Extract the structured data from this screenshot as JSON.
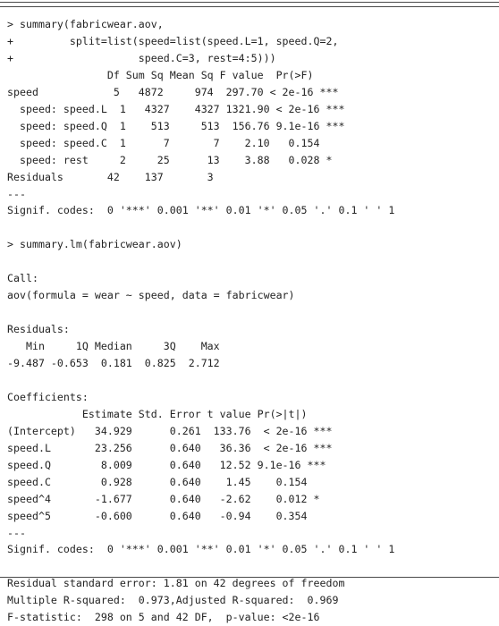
{
  "document": {
    "kind": "r-console-transcript",
    "top_rule_count": 2,
    "bottom_rule_count": 1,
    "text_color": "#232323",
    "background_color": "#ffffff"
  },
  "console": {
    "prompt_symbol": ">",
    "continuation_symbol": "+",
    "blocks": [
      {
        "name": "anova-summary-call",
        "lines": [
          "> summary(fabricwear.aov,",
          "+         split=list(speed=list(speed.L=1, speed.Q=2,",
          "+                    speed.C=3, rest=4:5)))"
        ]
      },
      {
        "name": "anova-table",
        "lines": [
          "                Df Sum Sq Mean Sq F value  Pr(>F)",
          "speed            5   4872     974  297.70 < 2e-16 ***",
          "  speed: speed.L  1   4327    4327 1321.90 < 2e-16 ***",
          "  speed: speed.Q  1    513     513  156.76 9.1e-16 ***",
          "  speed: speed.C  1      7       7    2.10   0.154",
          "  speed: rest     2     25      13    3.88   0.028 *",
          "Residuals       42    137       3",
          "---",
          "Signif. codes:  0 '***' 0.001 '**' 0.01 '*' 0.05 '.' 0.1 ' ' 1"
        ]
      },
      {
        "name": "lm-summary-call",
        "lines": [
          "> summary.lm(fabricwear.aov)"
        ]
      },
      {
        "name": "call-section",
        "lines": [
          "Call:",
          "aov(formula = wear ~ speed, data = fabricwear)"
        ]
      },
      {
        "name": "residuals-section",
        "lines": [
          "Residuals:",
          "   Min     1Q Median     3Q    Max",
          "-9.487 -0.653  0.181  0.825  2.712"
        ]
      },
      {
        "name": "coefficients-section",
        "lines": [
          "Coefficients:",
          "            Estimate Std. Error t value Pr(>|t|)",
          "(Intercept)   34.929      0.261  133.76  < 2e-16 ***",
          "speed.L       23.256      0.640   36.36  < 2e-16 ***",
          "speed.Q        8.009      0.640   12.52 9.1e-16 ***",
          "speed.C        0.928      0.640    1.45    0.154",
          "speed^4       -1.677      0.640   -2.62    0.012 *",
          "speed^5       -0.600      0.640   -0.94    0.354",
          "---",
          "Signif. codes:  0 '***' 0.001 '**' 0.01 '*' 0.05 '.' 0.1 ' ' 1"
        ]
      },
      {
        "name": "model-fit-section",
        "lines": [
          "Residual standard error: 1.81 on 42 degrees of freedom",
          "Multiple R-squared:  0.973,Adjusted R-squared:  0.969",
          "F-statistic:  298 on 5 and 42 DF,  p-value: <2e-16"
        ]
      }
    ]
  },
  "anova_table": {
    "columns": [
      "",
      "Df",
      "Sum Sq",
      "Mean Sq",
      "F value",
      "Pr(>F)",
      "signif"
    ],
    "rows": [
      [
        "speed",
        "5",
        "4872",
        "974",
        "297.70",
        "< 2e-16",
        "***"
      ],
      [
        "  speed: speed.L",
        "1",
        "4327",
        "4327",
        "1321.90",
        "< 2e-16",
        "***"
      ],
      [
        "  speed: speed.Q",
        "1",
        "513",
        "513",
        "156.76",
        "9.1e-16",
        "***"
      ],
      [
        "  speed: speed.C",
        "1",
        "7",
        "7",
        "2.10",
        "0.154",
        ""
      ],
      [
        "  speed: rest",
        "2",
        "25",
        "13",
        "3.88",
        "0.028",
        "*"
      ],
      [
        "Residuals",
        "42",
        "137",
        "3",
        "",
        "",
        ""
      ]
    ]
  },
  "residual_quantiles": {
    "labels": [
      "Min",
      "1Q",
      "Median",
      "3Q",
      "Max"
    ],
    "values": [
      "-9.487",
      "-0.653",
      "0.181",
      "0.825",
      "2.712"
    ]
  },
  "coefficients_table": {
    "columns": [
      "",
      "Estimate",
      "Std. Error",
      "t value",
      "Pr(>|t|)",
      "signif"
    ],
    "rows": [
      [
        "(Intercept)",
        "34.929",
        "0.261",
        "133.76",
        "< 2e-16",
        "***"
      ],
      [
        "speed.L",
        "23.256",
        "0.640",
        "36.36",
        "< 2e-16",
        "***"
      ],
      [
        "speed.Q",
        "8.009",
        "0.640",
        "12.52",
        "9.1e-16",
        "***"
      ],
      [
        "speed.C",
        "0.928",
        "0.640",
        "1.45",
        "0.154",
        ""
      ],
      [
        "speed^4",
        "-1.677",
        "0.640",
        "-2.62",
        "0.012",
        "*"
      ],
      [
        "speed^5",
        "-0.600",
        "0.640",
        "-0.94",
        "0.354",
        ""
      ]
    ]
  },
  "model_fit": {
    "residual_standard_error": "1.81",
    "residual_df": "42",
    "multiple_r_squared": "0.973",
    "adjusted_r_squared": "0.969",
    "f_statistic": "298",
    "f_df1": "5",
    "f_df2": "42",
    "p_value": "<2e-16"
  },
  "signif_codes": {
    "legend": "0 '***' 0.001 '**' 0.01 '*' 0.05 '.' 0.1 ' ' 1"
  },
  "lines": {
    "l01": "> summary(fabricwear.aov,",
    "l02": "+         split=list(speed=list(speed.L=1, speed.Q=2,",
    "l03": "+                    speed.C=3, rest=4:5)))",
    "l04": "                Df Sum Sq Mean Sq F value  Pr(>F)",
    "l05": "speed            5   4872     974  297.70 < 2e-16 ***",
    "l06": "  speed: speed.L  1   4327    4327 1321.90 < 2e-16 ***",
    "l07": "  speed: speed.Q  1    513     513  156.76 9.1e-16 ***",
    "l08": "  speed: speed.C  1      7       7    2.10   0.154",
    "l09": "  speed: rest     2     25      13    3.88   0.028 *",
    "l10": "Residuals       42    137       3",
    "l11": "---",
    "l12": "Signif. codes:  0 '***' 0.001 '**' 0.01 '*' 0.05 '.' 0.1 ' ' 1",
    "l13": "> summary.lm(fabricwear.aov)",
    "l14": "Call:",
    "l15": "aov(formula = wear ~ speed, data = fabricwear)",
    "l16": "Residuals:",
    "l17": "   Min     1Q Median     3Q    Max",
    "l18": "-9.487 -0.653  0.181  0.825  2.712",
    "l19": "Coefficients:",
    "l20": "            Estimate Std. Error t value Pr(>|t|)",
    "l21": "(Intercept)   34.929      0.261  133.76  < 2e-16 ***",
    "l22": "speed.L       23.256      0.640   36.36  < 2e-16 ***",
    "l23": "speed.Q        8.009      0.640   12.52 9.1e-16 ***",
    "l24": "speed.C        0.928      0.640    1.45    0.154",
    "l25": "speed^4       -1.677      0.640   -2.62    0.012 *",
    "l26": "speed^5       -0.600      0.640   -0.94    0.354",
    "l27": "---",
    "l28": "Signif. codes:  0 '***' 0.001 '**' 0.01 '*' 0.05 '.' 0.1 ' ' 1",
    "l29": "Residual standard error: 1.81 on 42 degrees of freedom",
    "l30": "Multiple R-squared:  0.973,Adjusted R-squared:  0.969",
    "l31": "F-statistic:  298 on 5 and 42 DF,  p-value: <2e-16"
  }
}
